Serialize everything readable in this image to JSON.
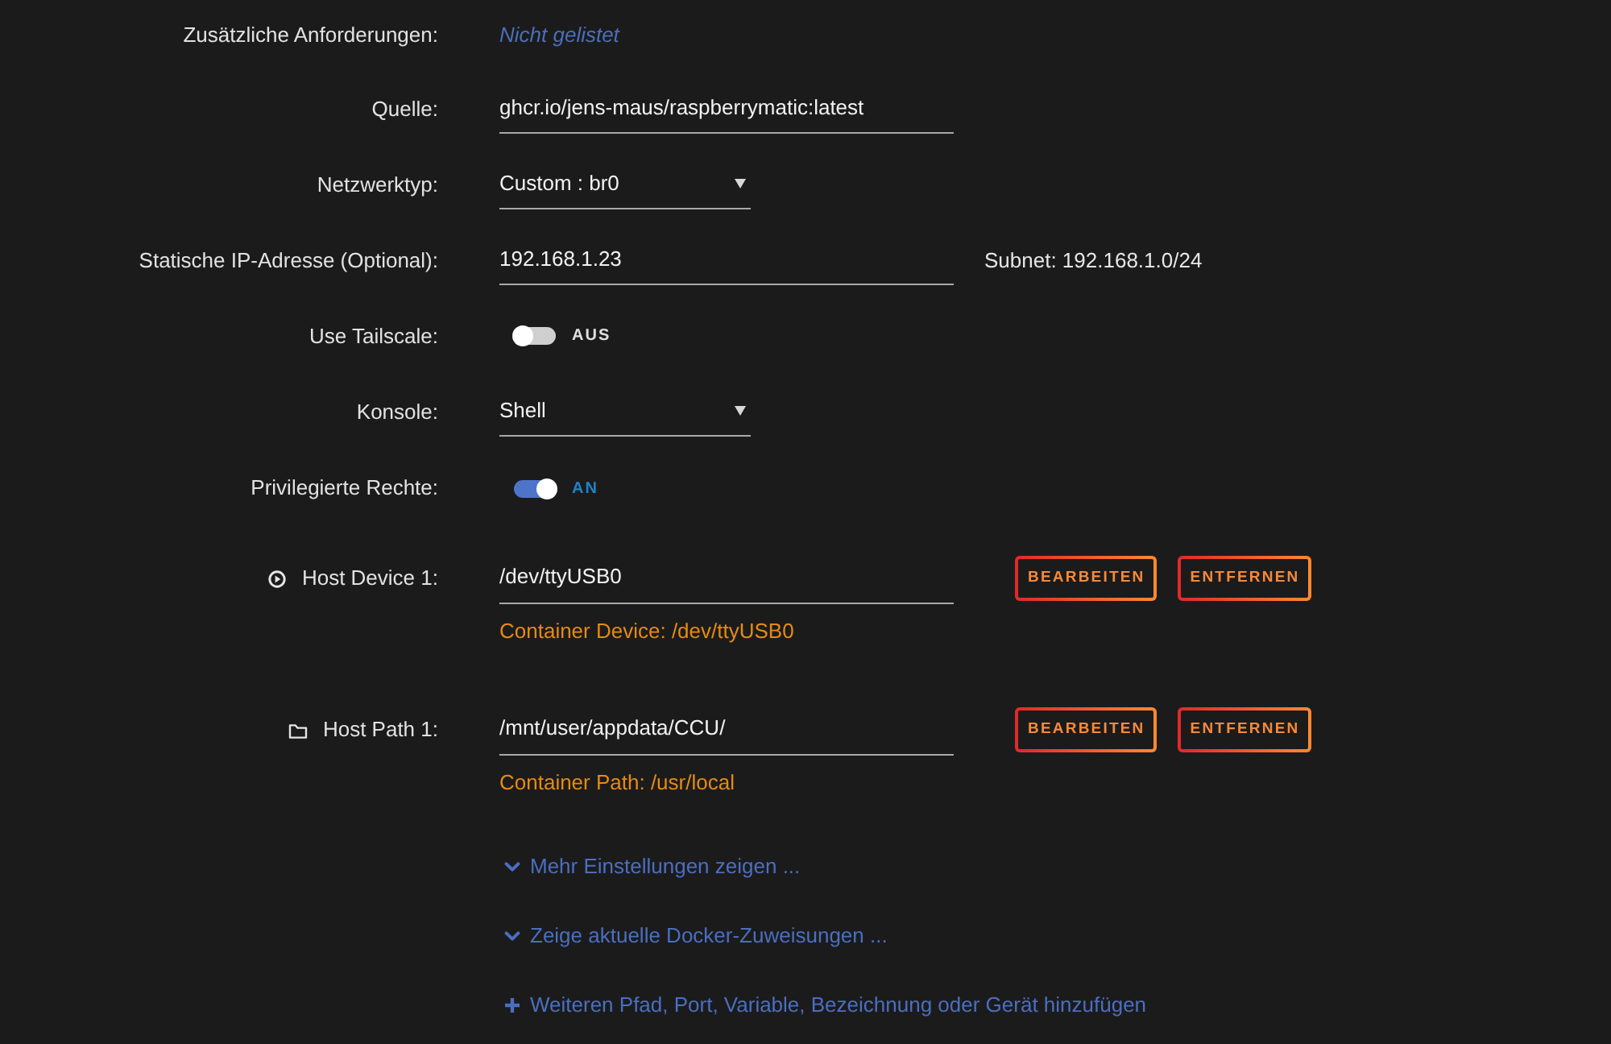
{
  "rows": [
    {
      "kind": "link-text",
      "label": "Zusätzliche Anforderungen:",
      "value": "Nicht gelistet"
    },
    {
      "kind": "text-field",
      "label": "Quelle:",
      "value": "ghcr.io/jens-maus/raspberrymatic:latest"
    },
    {
      "kind": "select",
      "label": "Netzwerktyp:",
      "value": "Custom : br0"
    },
    {
      "kind": "text-field",
      "label": "Statische IP-Adresse (Optional):",
      "value": "192.168.1.23",
      "note": "Subnet: 192.168.1.0/24"
    },
    {
      "kind": "switch",
      "label": "Use Tailscale:",
      "on": false,
      "state_text": "AUS"
    },
    {
      "kind": "select",
      "label": "Konsole:",
      "value": "Shell"
    },
    {
      "kind": "switch",
      "label": "Privilegierte Rechte:",
      "on": true,
      "state_text": "AN"
    }
  ],
  "mappings": [
    {
      "kind": "device",
      "label": "Host Device 1:",
      "value": "/dev/ttyUSB0",
      "container": "Container Device: /dev/ttyUSB0",
      "buttons": [
        "BEARBEITEN",
        "ENTFERNEN"
      ]
    },
    {
      "kind": "path",
      "label": "Host Path 1:",
      "value": "/mnt/user/appdata/CCU/",
      "container": "Container Path: /usr/local",
      "buttons": [
        "BEARBEITEN",
        "ENTFERNEN"
      ]
    }
  ],
  "actions": [
    {
      "kind": "expand",
      "text": "Mehr Einstellungen zeigen ..."
    },
    {
      "kind": "expand",
      "text": "Zeige aktuelle Docker-Zuweisungen ..."
    },
    {
      "kind": "add",
      "text": "Weiteren Pfad, Port, Variable, Bezeichnung oder Gerät hinzufügen"
    }
  ]
}
